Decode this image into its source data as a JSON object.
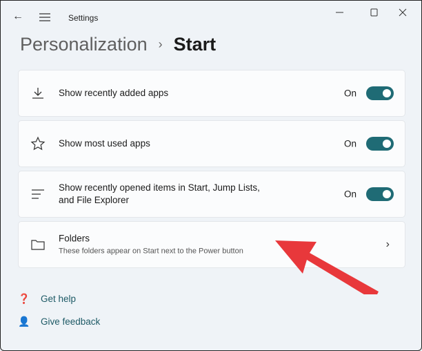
{
  "window": {
    "title": "Settings"
  },
  "breadcrumb": {
    "parent": "Personalization",
    "separator": "›",
    "current": "Start"
  },
  "settings": [
    {
      "label": "Show recently added apps",
      "icon": "download-icon",
      "state": "On",
      "toggle": true
    },
    {
      "label": "Show most used apps",
      "icon": "star-icon",
      "state": "On",
      "toggle": true
    },
    {
      "label": "Show recently opened items in Start, Jump Lists,",
      "label2": "and File Explorer",
      "icon": "list-icon",
      "state": "On",
      "toggle": true
    },
    {
      "label": "Folders",
      "sublabel": "These folders appear on Start next to the Power button",
      "icon": "folder-icon"
    }
  ],
  "links": {
    "help": "Get help",
    "feedback": "Give feedback"
  },
  "colors": {
    "accent": "#1f6b75",
    "arrow": "#e8383b"
  }
}
